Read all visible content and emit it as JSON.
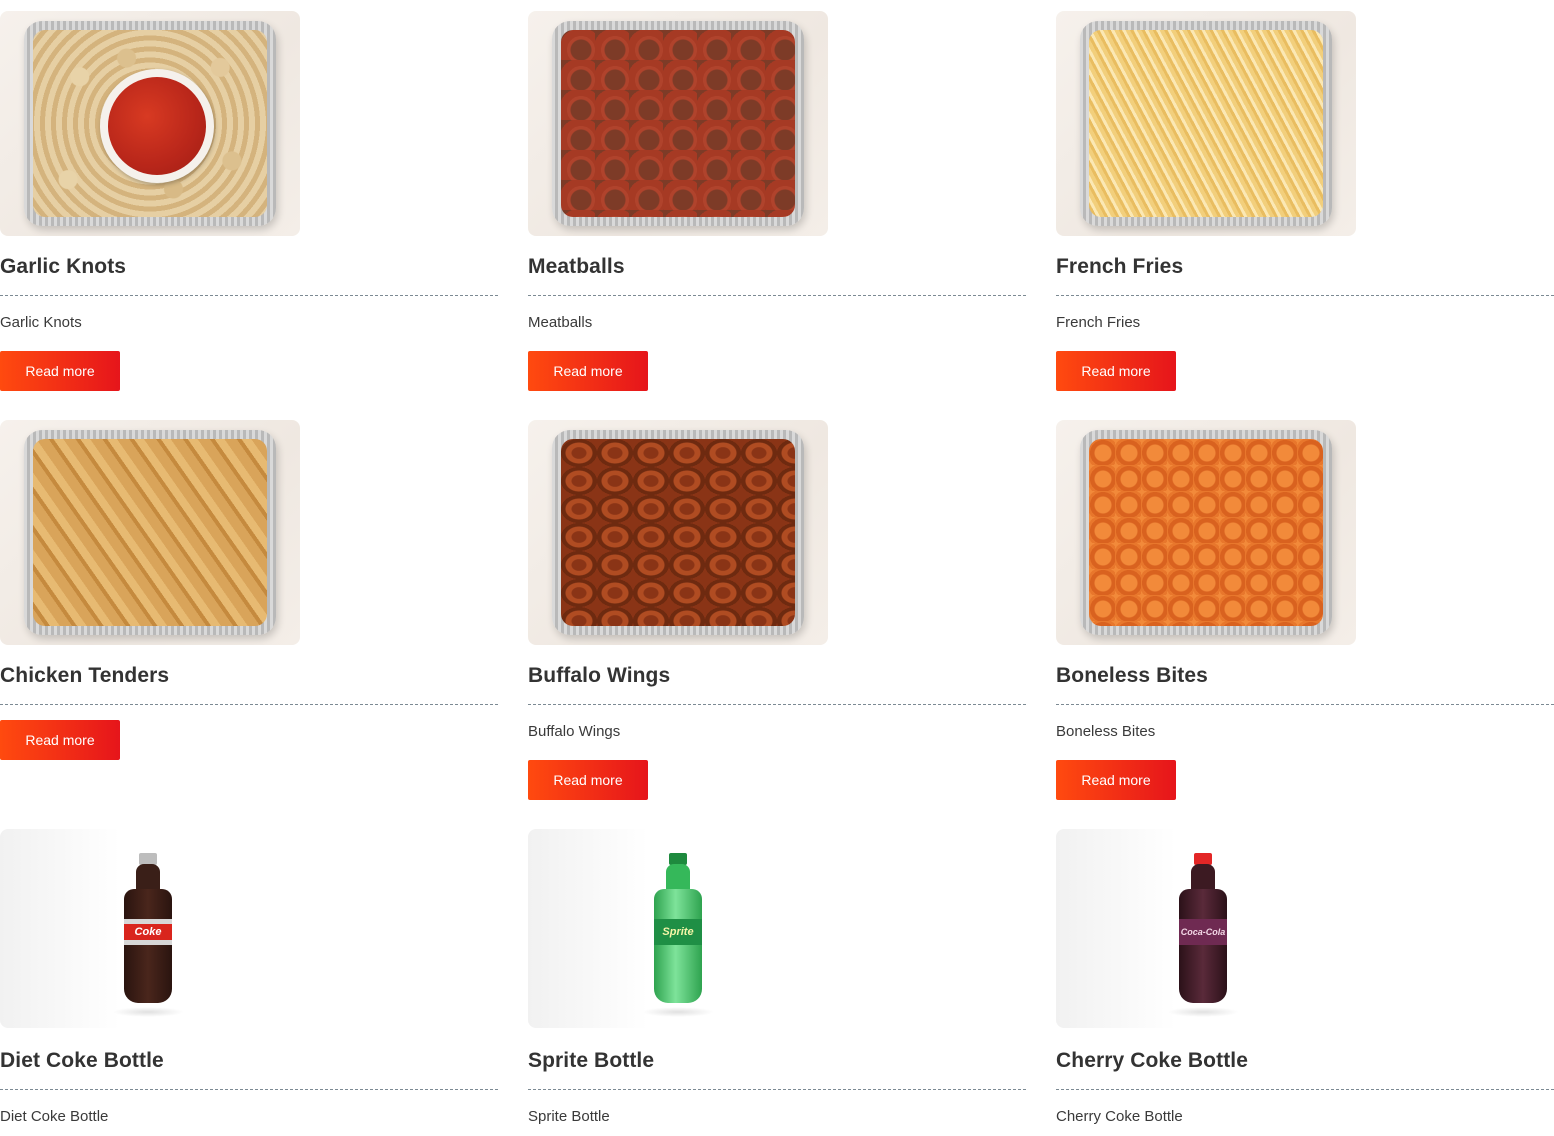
{
  "items": [
    {
      "title": "Garlic Knots",
      "desc": "Garlic Knots",
      "button": "Read more",
      "image_alt": "garlic-knots-tray"
    },
    {
      "title": "Meatballs",
      "desc": "Meatballs",
      "button": "Read more",
      "image_alt": "meatballs-tray"
    },
    {
      "title": "French Fries",
      "desc": "French Fries",
      "button": "Read more",
      "image_alt": "french-fries-tray"
    },
    {
      "title": "Chicken Tenders",
      "desc": "",
      "button": "Read more",
      "image_alt": "chicken-tenders-tray"
    },
    {
      "title": "Buffalo Wings",
      "desc": "Buffalo Wings",
      "button": "Read more",
      "image_alt": "buffalo-wings-tray"
    },
    {
      "title": "Boneless Bites",
      "desc": "Boneless Bites",
      "button": "Read more",
      "image_alt": "boneless-bites-tray"
    },
    {
      "title": "Diet Coke Bottle",
      "desc": "Diet Coke Bottle",
      "image_alt": "diet-coke-bottle",
      "bottle_label": "Coke"
    },
    {
      "title": "Sprite Bottle",
      "desc": "Sprite Bottle",
      "image_alt": "sprite-bottle",
      "bottle_label": "Sprite"
    },
    {
      "title": "Cherry Coke Bottle",
      "desc": "Cherry Coke Bottle",
      "image_alt": "cherry-coke-bottle",
      "bottle_label": "Coca-Cola"
    }
  ],
  "colors": {
    "button_gradient_start": "#ff4a0f",
    "button_gradient_end": "#e6151b",
    "title": "#333333",
    "divider": "#7c8a93"
  }
}
